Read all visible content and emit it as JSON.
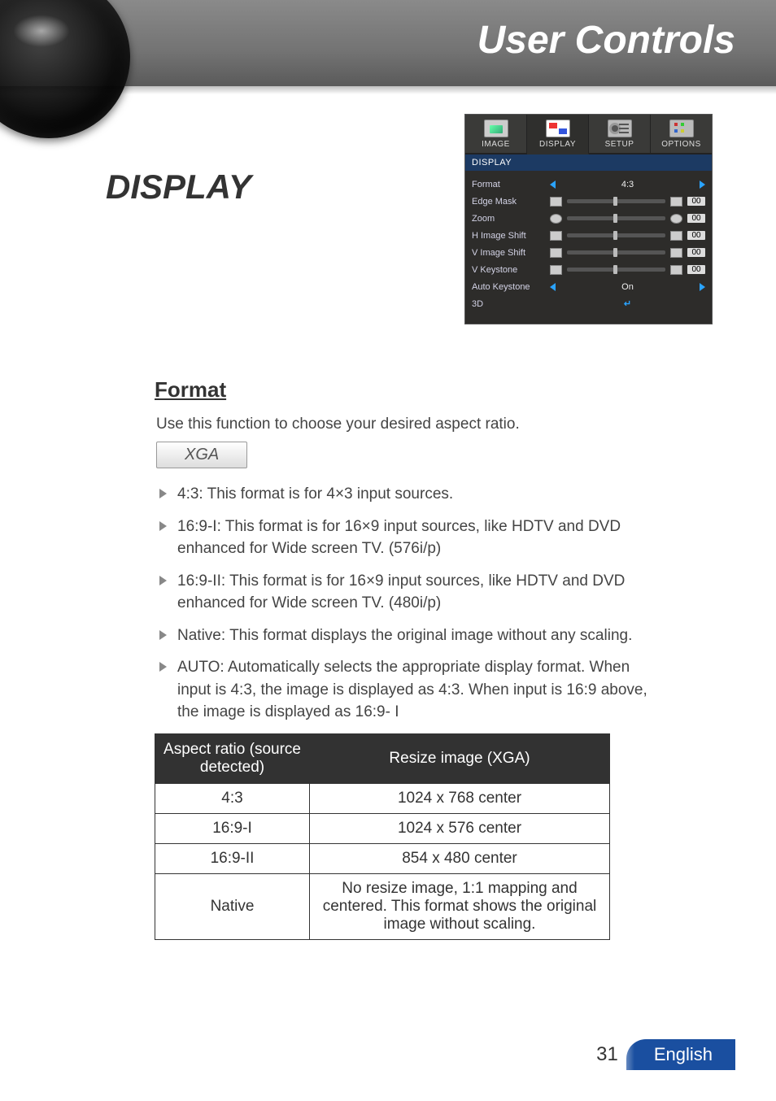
{
  "header": {
    "title": "User Controls"
  },
  "section_title": "DISPLAY",
  "osd": {
    "tabs": [
      "IMAGE",
      "DISPLAY",
      "SETUP",
      "OPTIONS"
    ],
    "active_tab_index": 1,
    "section_label": "DISPLAY",
    "rows": {
      "format": {
        "label": "Format",
        "value": "4:3"
      },
      "edge_mask": {
        "label": "Edge Mask",
        "value": "00"
      },
      "zoom": {
        "label": "Zoom",
        "value": "00"
      },
      "h_image_shift": {
        "label": "H Image Shift",
        "value": "00"
      },
      "v_image_shift": {
        "label": "V Image Shift",
        "value": "00"
      },
      "v_keystone": {
        "label": "V Keystone",
        "value": "00"
      },
      "auto_keystone": {
        "label": "Auto Keystone",
        "value": "On"
      },
      "three_d": {
        "label": "3D"
      }
    }
  },
  "format": {
    "heading": "Format",
    "intro": "Use this function to choose your desired aspect ratio.",
    "tag": "XGA",
    "items": [
      "4:3: This format is for 4×3 input sources.",
      "16:9-I: This format is for 16×9 input sources, like HDTV and DVD enhanced for Wide screen TV. (576i/p)",
      "16:9-II: This format is for 16×9 input sources, like HDTV and DVD enhanced for Wide screen TV. (480i/p)",
      "Native: This format displays the original image without any scaling.",
      "AUTO: Automatically selects the appropriate display format. When input is 4:3, the image is displayed as 4:3. When input is 16:9 above, the image is displayed as 16:9- I"
    ],
    "table": {
      "headers": [
        "Aspect ratio (source detected)",
        "Resize image (XGA)"
      ],
      "rows": [
        [
          "4:3",
          "1024 x 768 center"
        ],
        [
          "16:9-I",
          "1024 x 576 center"
        ],
        [
          "16:9-II",
          "854 x 480 center"
        ],
        [
          "Native",
          "No resize image, 1:1 mapping and centered. This format shows the original image without scaling."
        ]
      ]
    }
  },
  "footer": {
    "page": "31",
    "language": "English"
  }
}
